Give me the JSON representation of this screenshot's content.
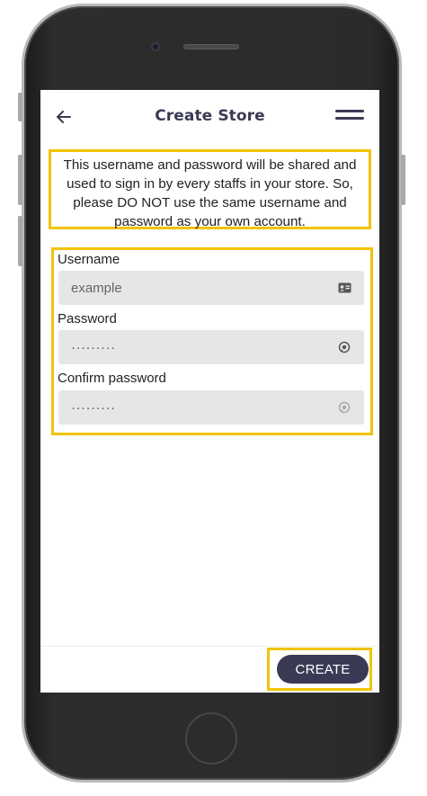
{
  "header": {
    "title": "Create Store",
    "back_icon": "arrow-left-icon",
    "menu_icon": "hamburger-menu-icon"
  },
  "notice": {
    "text": "This username and password will be shared and used to sign in by every staffs in your store. So, please DO NOT use the same username and password as your own account."
  },
  "form": {
    "username": {
      "label": "Username",
      "placeholder": "example",
      "icon": "id-card-icon"
    },
    "password": {
      "label": "Password",
      "value": "·········",
      "icon": "eye-icon"
    },
    "confirm_password": {
      "label": "Confirm password",
      "value": "·········",
      "icon": "eye-icon"
    }
  },
  "footer": {
    "create_label": "CREATE"
  },
  "colors": {
    "primary": "#3b3a55",
    "highlight": "#f2c300",
    "field_bg": "#e6e6e6"
  }
}
